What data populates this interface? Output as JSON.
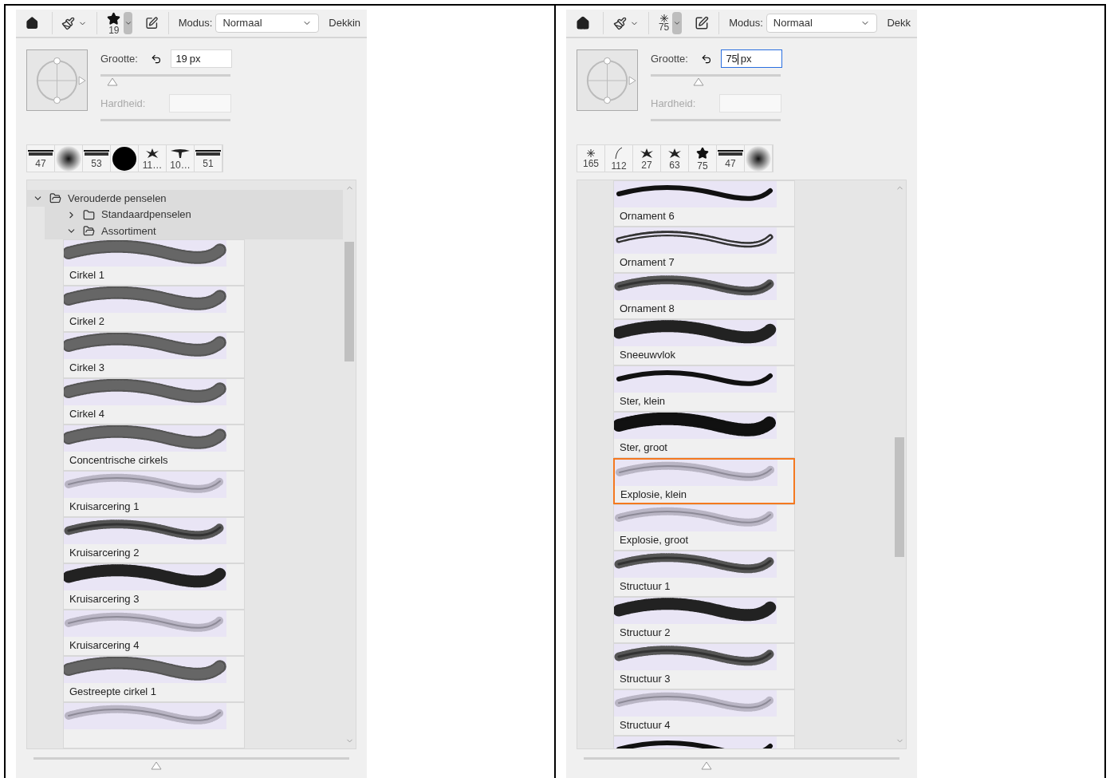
{
  "panels": [
    {
      "toolbar": {
        "preset": {
          "kind": "star",
          "size": "19"
        },
        "mode_label": "Modus:",
        "mode_value": "Normaal",
        "opacity_label": "Dekkin"
      },
      "size_label": "Grootte:",
      "size_value": "19",
      "size_unit": "px",
      "size_focused": false,
      "size_slider": {
        "level": 0.09
      },
      "hardness_label": "Hardheid:",
      "presets": [
        {
          "kind": "logo",
          "label": "47"
        },
        {
          "kind": "soft"
        },
        {
          "kind": "logo",
          "label": "53"
        },
        {
          "kind": "dot"
        },
        {
          "kind": "splash",
          "label": "11…"
        },
        {
          "kind": "tree",
          "label": "10…"
        },
        {
          "kind": "logo",
          "label": "51"
        }
      ],
      "tree": [
        {
          "label": "Verouderde penselen",
          "expanded": true,
          "children": [
            {
              "label": "Standaardpenselen",
              "expanded": false
            },
            {
              "label": "Assortiment",
              "expanded": true
            }
          ]
        }
      ],
      "brushes": [
        {
          "name": "Cirkel 1",
          "kind": "rings",
          "selected": false
        },
        {
          "name": "Cirkel 2",
          "kind": "rings",
          "selected": false
        },
        {
          "name": "Cirkel 3",
          "kind": "rings",
          "selected": false
        },
        {
          "name": "Cirkel 4",
          "kind": "rings",
          "selected": false
        },
        {
          "name": "Concentrische cirkels",
          "kind": "rings",
          "selected": false
        },
        {
          "name": "Kruisarcering 1",
          "kind": "faint",
          "selected": false
        },
        {
          "name": "Kruisarcering 2",
          "kind": "hatch",
          "selected": false
        },
        {
          "name": "Kruisarcering 3",
          "kind": "dense",
          "selected": false
        },
        {
          "name": "Kruisarcering 4",
          "kind": "faint",
          "selected": false
        },
        {
          "name": "Gestreepte cirkel 1",
          "kind": "rings",
          "selected": false
        },
        {
          "kind": "faint",
          "selected": false
        }
      ],
      "thumb_slider": {
        "level": 0.39
      }
    },
    {
      "toolbar": {
        "preset": {
          "kind": "sparkle",
          "size": "75"
        },
        "mode_label": "Modus:",
        "mode_value": "Normaal",
        "opacity_label": "Dekk"
      },
      "size_label": "Grootte:",
      "size_value": "75",
      "size_unit": "px",
      "size_focused": true,
      "size_slider": {
        "level": 0.37
      },
      "hardness_label": "Hardheid:",
      "presets": [
        {
          "kind": "sparkle",
          "label": "165"
        },
        {
          "kind": "stroke",
          "label": "112"
        },
        {
          "kind": "splash",
          "label": "27"
        },
        {
          "kind": "splash",
          "label": "63"
        },
        {
          "kind": "star",
          "label": "75"
        },
        {
          "kind": "logo",
          "label": "47"
        },
        {
          "kind": "soft"
        }
      ],
      "brushes": [
        {
          "name": "Ornament 6",
          "kind": "solid",
          "selected": false
        },
        {
          "name": "Ornament 7",
          "kind": "thin",
          "selected": false
        },
        {
          "name": "Ornament 8",
          "kind": "hatch",
          "selected": false
        },
        {
          "name": "Sneeuwvlok",
          "kind": "dense",
          "selected": false
        },
        {
          "name": "Ster, klein",
          "kind": "solid",
          "selected": false
        },
        {
          "name": "Ster, groot",
          "kind": "spiky",
          "selected": false
        },
        {
          "name": "Explosie, klein",
          "kind": "faint",
          "selected": true
        },
        {
          "name": "Explosie, groot",
          "kind": "faint",
          "selected": false
        },
        {
          "name": "Structuur 1",
          "kind": "hatch",
          "selected": false
        },
        {
          "name": "Structuur 2",
          "kind": "dense",
          "selected": false
        },
        {
          "name": "Structuur 3",
          "kind": "hatch",
          "selected": false
        },
        {
          "name": "Structuur 4",
          "kind": "faint",
          "selected": false
        },
        {
          "kind": "solid",
          "selected": false
        }
      ],
      "thumb_slider": {
        "level": 0.39
      }
    }
  ]
}
